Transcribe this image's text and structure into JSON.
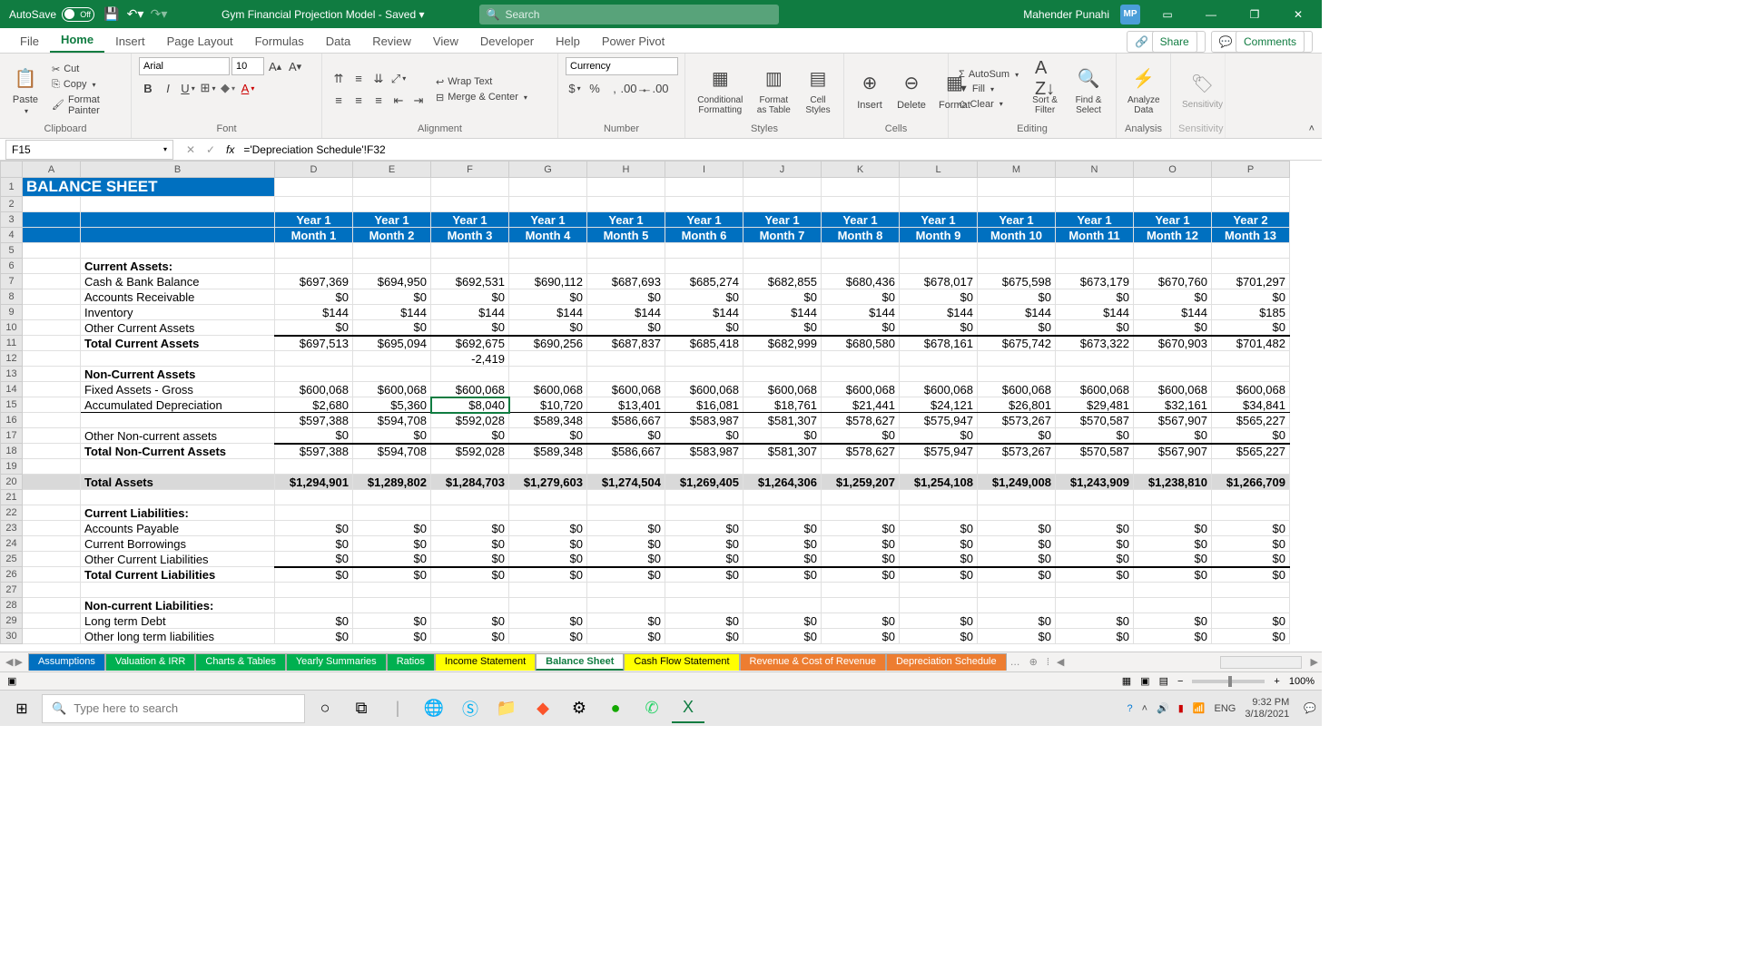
{
  "title": {
    "autosave_label": "AutoSave",
    "autosave_state": "Off",
    "doc_name": "Gym Financial Projection Model  -  Saved  ▾",
    "search_placeholder": "Search",
    "user_name": "Mahender Punahi",
    "user_initials": "MP"
  },
  "ribbon_tabs": [
    "File",
    "Home",
    "Insert",
    "Page Layout",
    "Formulas",
    "Data",
    "Review",
    "View",
    "Developer",
    "Help",
    "Power Pivot"
  ],
  "ribbon_active": "Home",
  "share_label": "Share",
  "comments_label": "Comments",
  "ribbon": {
    "clipboard": {
      "paste": "Paste",
      "cut": "Cut",
      "copy": "Copy",
      "format_painter": "Format Painter",
      "label": "Clipboard"
    },
    "font": {
      "name": "Arial",
      "size": "10",
      "label": "Font"
    },
    "alignment": {
      "wrap": "Wrap Text",
      "merge": "Merge & Center",
      "label": "Alignment"
    },
    "number": {
      "format": "Currency",
      "label": "Number"
    },
    "styles": {
      "cond": "Conditional Formatting",
      "table": "Format as Table",
      "cell": "Cell Styles",
      "label": "Styles"
    },
    "cells": {
      "insert": "Insert",
      "delete": "Delete",
      "format": "Format",
      "label": "Cells"
    },
    "editing": {
      "autosum": "AutoSum",
      "fill": "Fill",
      "clear": "Clear",
      "sort": "Sort & Filter",
      "find": "Find & Select",
      "label": "Editing"
    },
    "analysis": {
      "analyze": "Analyze Data",
      "label": "Analysis"
    },
    "sensitivity": {
      "btn": "Sensitivity",
      "label": "Sensitivity"
    }
  },
  "namebox": "F15",
  "formula": "='Depreciation Schedule'!F32",
  "columns": [
    "A",
    "B",
    "D",
    "E",
    "F",
    "G",
    "H",
    "I",
    "J",
    "K",
    "L",
    "M",
    "N",
    "O",
    "P"
  ],
  "sheet_title": "BALANCE SHEET",
  "years": [
    "Year 1",
    "Year 1",
    "Year 1",
    "Year 1",
    "Year 1",
    "Year 1",
    "Year 1",
    "Year 1",
    "Year 1",
    "Year 1",
    "Year 1",
    "Year 1",
    "Year 2"
  ],
  "months": [
    "Month 1",
    "Month 2",
    "Month 3",
    "Month 4",
    "Month 5",
    "Month 6",
    "Month 7",
    "Month 8",
    "Month 9",
    "Month 10",
    "Month 11",
    "Month 12",
    "Month 13"
  ],
  "labels": {
    "current_assets": "Current Assets:",
    "cash": "Cash & Bank Balance",
    "ar": "Accounts Receivable",
    "inv": "Inventory",
    "oca": "Other Current Assets",
    "tca": "Total Current Assets",
    "nca": "Non-Current Assets",
    "fag": "Fixed Assets - Gross",
    "ad": "Accumulated Depreciation",
    "onca": "Other Non-current assets",
    "tnca": "Total Non-Current Assets",
    "ta": "Total Assets",
    "cl": "Current Liabilities:",
    "ap": "Accounts Payable",
    "cb": "Current Borrowings",
    "ocl": "Other Current Liabilities",
    "tcl": "Total Current Liabilities",
    "ncl": "Non-current Liabilities:",
    "ltd": "Long term Debt",
    "oltl": "Other long term liabilities"
  },
  "rows": {
    "cash": [
      "$697,369",
      "$694,950",
      "$692,531",
      "$690,112",
      "$687,693",
      "$685,274",
      "$682,855",
      "$680,436",
      "$678,017",
      "$675,598",
      "$673,179",
      "$670,760",
      "$701,297"
    ],
    "ar": [
      "$0",
      "$0",
      "$0",
      "$0",
      "$0",
      "$0",
      "$0",
      "$0",
      "$0",
      "$0",
      "$0",
      "$0",
      "$0"
    ],
    "inv": [
      "$144",
      "$144",
      "$144",
      "$144",
      "$144",
      "$144",
      "$144",
      "$144",
      "$144",
      "$144",
      "$144",
      "$144",
      "$185"
    ],
    "oca": [
      "$0",
      "$0",
      "$0",
      "$0",
      "$0",
      "$0",
      "$0",
      "$0",
      "$0",
      "$0",
      "$0",
      "$0",
      "$0"
    ],
    "tca": [
      "$697,513",
      "$695,094",
      "$692,675",
      "$690,256",
      "$687,837",
      "$685,418",
      "$682,999",
      "$680,580",
      "$678,161",
      "$675,742",
      "$673,322",
      "$670,903",
      "$701,482"
    ],
    "adj12": [
      "",
      "",
      "-2,419",
      "",
      "",
      "",
      "",
      "",
      "",
      "",
      "",
      "",
      ""
    ],
    "fag": [
      "$600,068",
      "$600,068",
      "$600,068",
      "$600,068",
      "$600,068",
      "$600,068",
      "$600,068",
      "$600,068",
      "$600,068",
      "$600,068",
      "$600,068",
      "$600,068",
      "$600,068"
    ],
    "ad": [
      "$2,680",
      "$5,360",
      "$8,040",
      "$10,720",
      "$13,401",
      "$16,081",
      "$18,761",
      "$21,441",
      "$24,121",
      "$26,801",
      "$29,481",
      "$32,161",
      "$34,841"
    ],
    "net": [
      "$597,388",
      "$594,708",
      "$592,028",
      "$589,348",
      "$586,667",
      "$583,987",
      "$581,307",
      "$578,627",
      "$575,947",
      "$573,267",
      "$570,587",
      "$567,907",
      "$565,227"
    ],
    "onca": [
      "$0",
      "$0",
      "$0",
      "$0",
      "$0",
      "$0",
      "$0",
      "$0",
      "$0",
      "$0",
      "$0",
      "$0",
      "$0"
    ],
    "tnca": [
      "$597,388",
      "$594,708",
      "$592,028",
      "$589,348",
      "$586,667",
      "$583,987",
      "$581,307",
      "$578,627",
      "$575,947",
      "$573,267",
      "$570,587",
      "$567,907",
      "$565,227"
    ],
    "ta": [
      "$1,294,901",
      "$1,289,802",
      "$1,284,703",
      "$1,279,603",
      "$1,274,504",
      "$1,269,405",
      "$1,264,306",
      "$1,259,207",
      "$1,254,108",
      "$1,249,008",
      "$1,243,909",
      "$1,238,810",
      "$1,266,709"
    ],
    "ap": [
      "$0",
      "$0",
      "$0",
      "$0",
      "$0",
      "$0",
      "$0",
      "$0",
      "$0",
      "$0",
      "$0",
      "$0",
      "$0"
    ],
    "cb": [
      "$0",
      "$0",
      "$0",
      "$0",
      "$0",
      "$0",
      "$0",
      "$0",
      "$0",
      "$0",
      "$0",
      "$0",
      "$0"
    ],
    "ocl": [
      "$0",
      "$0",
      "$0",
      "$0",
      "$0",
      "$0",
      "$0",
      "$0",
      "$0",
      "$0",
      "$0",
      "$0",
      "$0"
    ],
    "tcl": [
      "$0",
      "$0",
      "$0",
      "$0",
      "$0",
      "$0",
      "$0",
      "$0",
      "$0",
      "$0",
      "$0",
      "$0",
      "$0"
    ],
    "ltd": [
      "$0",
      "$0",
      "$0",
      "$0",
      "$0",
      "$0",
      "$0",
      "$0",
      "$0",
      "$0",
      "$0",
      "$0",
      "$0"
    ],
    "oltl": [
      "$0",
      "$0",
      "$0",
      "$0",
      "$0",
      "$0",
      "$0",
      "$0",
      "$0",
      "$0",
      "$0",
      "$0",
      "$0"
    ]
  },
  "sheet_tabs": [
    {
      "name": "Assumptions",
      "class": "c-blue"
    },
    {
      "name": "Valuation & IRR",
      "class": "c-green"
    },
    {
      "name": "Charts & Tables",
      "class": "c-green"
    },
    {
      "name": "Yearly Summaries",
      "class": "c-green"
    },
    {
      "name": "Ratios",
      "class": "c-green"
    },
    {
      "name": "Income Statement",
      "class": "c-yellow"
    },
    {
      "name": "Balance Sheet",
      "class": "active"
    },
    {
      "name": "Cash Flow Statement",
      "class": "c-yellow"
    },
    {
      "name": "Revenue & Cost of Revenue",
      "class": "c-orange"
    },
    {
      "name": "Depreciation Schedule",
      "class": "c-orange"
    }
  ],
  "status": {
    "zoom": "100%"
  },
  "taskbar": {
    "search": "Type here to search",
    "time": "9:32 PM",
    "date": "3/18/2021",
    "lang": "ENG"
  }
}
